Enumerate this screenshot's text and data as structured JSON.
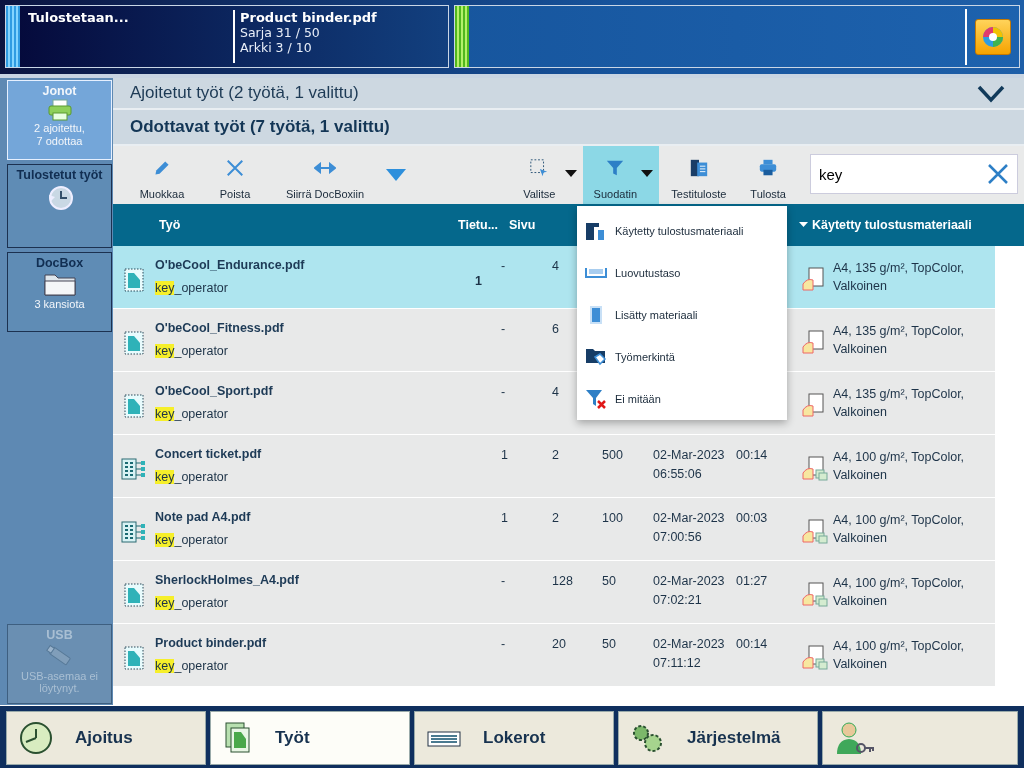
{
  "status": {
    "state": "Tulostetaan...",
    "job": "Product binder.pdf",
    "lines": [
      "Sarja 31 / 50",
      "Arkki 3 / 10"
    ]
  },
  "sidebar": [
    {
      "title": "Jonot",
      "lines": [
        "2 ajoitettu,",
        "7 odottaa"
      ],
      "selected": true,
      "disabled": false
    },
    {
      "title": "Tulostetut työt",
      "selected": false,
      "disabled": false
    },
    {
      "title": "DocBox",
      "lines": [
        "3 kansiota"
      ],
      "selected": false,
      "disabled": false
    },
    {
      "title": "USB",
      "lines": [
        "USB-asemaa ei löytynyt."
      ],
      "selected": false,
      "disabled": true
    }
  ],
  "scheduled_header": {
    "title": "Ajoitetut työt (2 työtä, 1 valittu)",
    "expanded": false
  },
  "waiting_header": {
    "title": "Odottavat työt (7 työtä, 1 valittu)"
  },
  "toolbar": [
    {
      "label": "Muokkaa",
      "dropdown": false,
      "selected": false
    },
    {
      "label": "Poista",
      "dropdown": false,
      "selected": false
    },
    {
      "label": "Siirrä DocBoxiin",
      "dropdown": false,
      "selected": false
    },
    {
      "label": "Valitse",
      "dropdown": true,
      "selected": false
    },
    {
      "label": "Suodatin",
      "dropdown": true,
      "selected": true
    },
    {
      "label": "Testituloste",
      "dropdown": false,
      "selected": false
    },
    {
      "label": "Tulosta",
      "dropdown": false,
      "selected": false
    }
  ],
  "search": {
    "value": "key"
  },
  "columns": [
    "Työ",
    "Tietu...",
    "Sivu",
    "Käytetty tulostusmateriaali"
  ],
  "rows": [
    {
      "kind": "document",
      "name": "O'beCool_Endurance.pdf",
      "match": "key",
      "rest": "_operator",
      "count": "1",
      "records": "-",
      "pages": "4",
      "mixed_media": false,
      "material": "A4, 135 g/m², TopColor, Valkoinen",
      "selected": true
    },
    {
      "kind": "document",
      "name": "O'beCool_Fitness.pdf",
      "match": "key",
      "rest": "_operator",
      "records": "-",
      "pages": "6",
      "mixed_media": false,
      "material": "A4, 135 g/m², TopColor, Valkoinen",
      "selected": false
    },
    {
      "kind": "document",
      "name": "O'beCool_Sport.pdf",
      "match": "key",
      "rest": "_operator",
      "records": "-",
      "pages": "4",
      "mixed_media": false,
      "material": "A4, 135 g/m², TopColor, Valkoinen",
      "selected": false
    },
    {
      "kind": "variable",
      "name": "Concert ticket.pdf",
      "match": "key",
      "rest": "_operator",
      "records": "1",
      "pages": "2",
      "copies": "500",
      "date": "02-Mar-2023",
      "time": "06:55:06",
      "duration": "00:14",
      "mixed_media": true,
      "material": "A4, 100 g/m², TopColor, Valkoinen",
      "selected": false
    },
    {
      "kind": "variable",
      "name": "Note pad A4.pdf",
      "match": "key",
      "rest": "_operator",
      "records": "1",
      "pages": "2",
      "copies": "100",
      "date": "02-Mar-2023",
      "time": "07:00:56",
      "duration": "00:03",
      "mixed_media": true,
      "material": "A4, 100 g/m², TopColor, Valkoinen",
      "selected": false
    },
    {
      "kind": "document",
      "name": "SherlockHolmes_A4.pdf",
      "match": "key",
      "rest": "_operator",
      "records": "-",
      "pages": "128",
      "copies": "50",
      "date": "02-Mar-2023",
      "time": "07:02:21",
      "duration": "01:27",
      "mixed_media": true,
      "material": "A4, 100 g/m², TopColor, Valkoinen",
      "selected": false
    },
    {
      "kind": "document",
      "name": "Product binder.pdf",
      "match": "key",
      "rest": "_operator",
      "records": "-",
      "pages": "20",
      "copies": "50",
      "date": "02-Mar-2023",
      "time": "07:11:12",
      "duration": "00:14",
      "mixed_media": true,
      "material": "A4, 100 g/m², TopColor, Valkoinen",
      "selected": false
    }
  ],
  "filter_menu": [
    "Käytetty tulostusmateriaali",
    "Luovutustaso",
    "Lisätty materiaali",
    "Työmerkintä",
    "Ei mitään"
  ],
  "bottom_tabs": [
    {
      "label": "Ajoitus",
      "selected": false
    },
    {
      "label": "Työt",
      "selected": true
    },
    {
      "label": "Lokerot",
      "selected": false
    },
    {
      "label": "Järjestelmä",
      "selected": false
    },
    {
      "selected": false
    }
  ]
}
